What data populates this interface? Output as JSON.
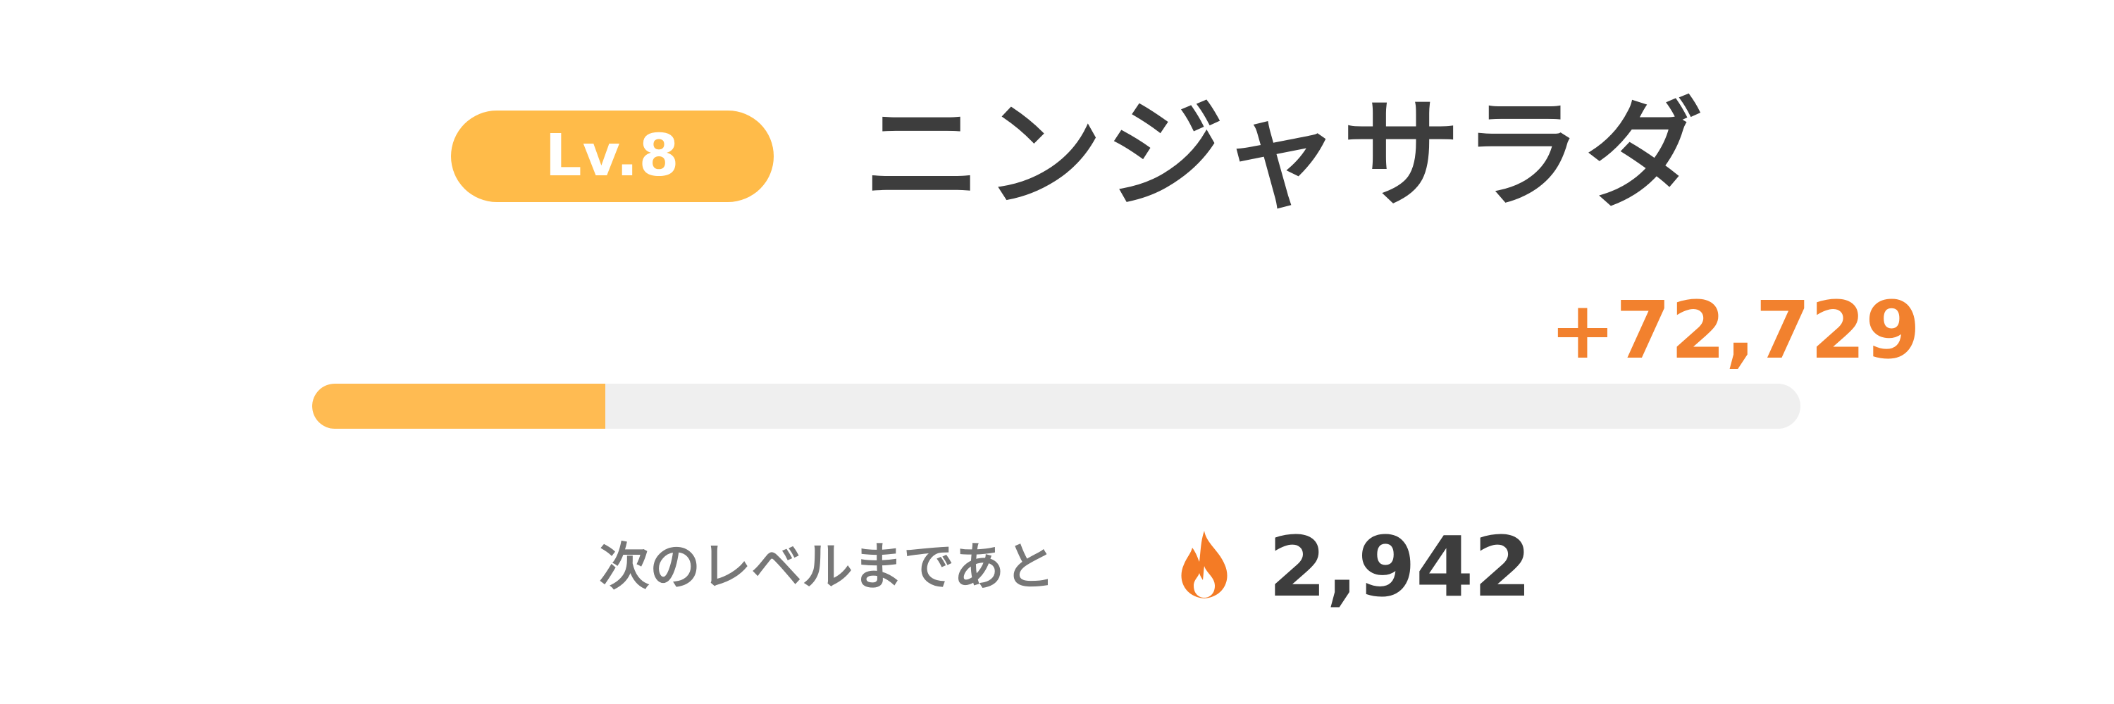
{
  "level": {
    "label": "Lv.8",
    "color": "#ffbb49"
  },
  "dish": {
    "name": "ニンジャサラダ"
  },
  "experience": {
    "gain": "+72,729",
    "gain_color": "#f2812e",
    "progress_fraction": 0.197,
    "progress_color": "#ffbb52",
    "track_color": "#efefef"
  },
  "next_level": {
    "label": "次のレベルまであと",
    "icon": "flame-icon",
    "remaining": "2,942"
  }
}
